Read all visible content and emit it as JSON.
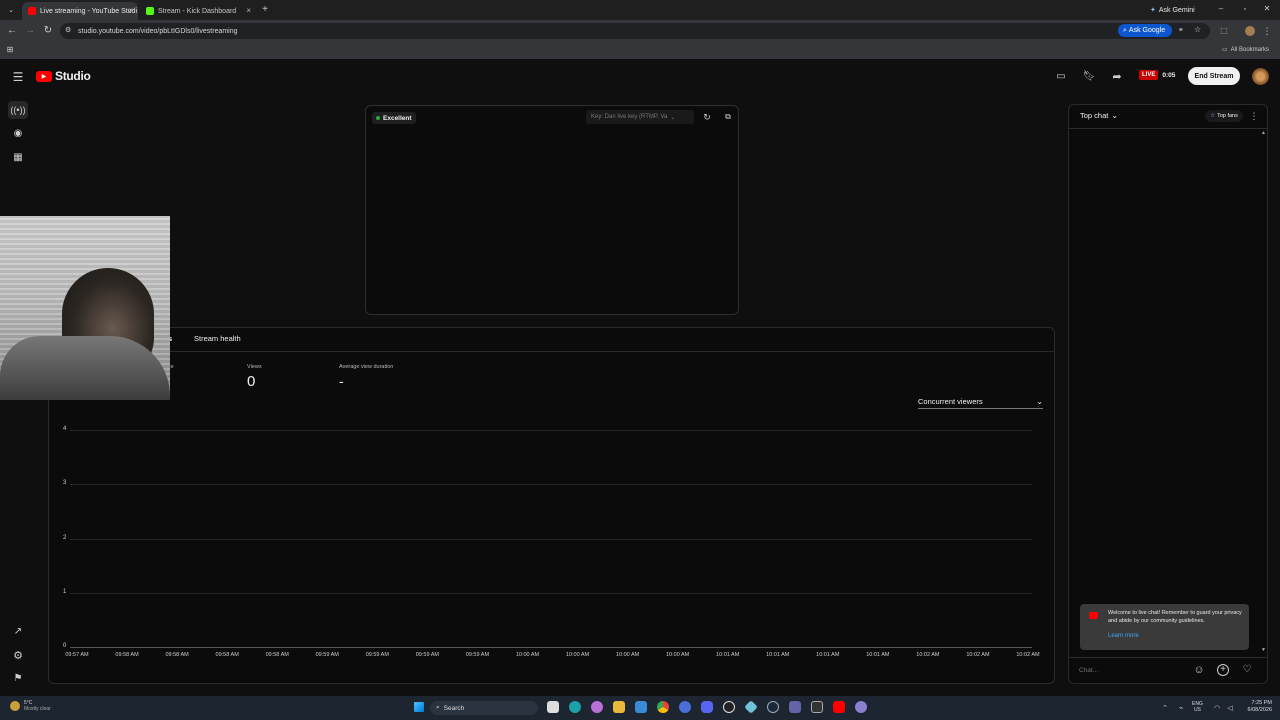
{
  "browser": {
    "tabs": [
      {
        "label": "Live streaming - YouTube Studi",
        "active": true
      },
      {
        "label": "Stream - Kick Dashboard",
        "active": false
      }
    ],
    "ask_gemini": "Ask Gemini",
    "url": "studio.youtube.com/video/pbLtIGDls0/livestreaming",
    "ask_google": "Ask Google",
    "all_bookmarks": "All Bookmarks"
  },
  "studio": {
    "logo_text": "Studio",
    "live_badge": "LIVE",
    "live_time": "0:05",
    "end_stream": "End Stream"
  },
  "preview": {
    "status": "Excellent",
    "stream_key": "Key: Dan live key (RTMP, Va"
  },
  "analytics": {
    "tabs": [
      "s",
      "Stream health"
    ],
    "metrics": [
      {
        "label": "ate",
        "value": ""
      },
      {
        "label": "Views",
        "value": "0"
      },
      {
        "label": "Average view duration",
        "value": "-"
      }
    ],
    "dropdown": "Concurrent viewers"
  },
  "chart_data": {
    "type": "line",
    "x": [
      "09:57 AM",
      "09:58 AM",
      "09:58 AM",
      "09:58 AM",
      "09:58 AM",
      "09:59 AM",
      "09:59 AM",
      "09:59 AM",
      "09:59 AM",
      "10:00 AM",
      "10:00 AM",
      "10:00 AM",
      "10:00 AM",
      "10:01 AM",
      "10:01 AM",
      "10:01 AM",
      "10:01 AM",
      "10:02 AM",
      "10:02 AM",
      "10:02 AM"
    ],
    "yticks": [
      "0",
      "1",
      "2",
      "3",
      "4"
    ],
    "ylim": [
      0,
      4
    ],
    "series": [],
    "grid": true
  },
  "chat": {
    "title": "Top chat",
    "top_fans": "Top fans",
    "welcome": "Welcome to live chat! Remember to guard your privacy and abide by our community guidelines.",
    "learn_more": "Learn more",
    "input_placeholder": "Chat..."
  },
  "taskbar": {
    "temp": "5°C",
    "weather": "Mostly clear",
    "search": "Search",
    "lang": "ENG",
    "region": "US",
    "time": "7:25 PM",
    "date": "6/08/2026"
  },
  "colors": {
    "accent_red": "#ff0000",
    "link_blue": "#3ea6ff",
    "excellent_green": "#2ba640"
  }
}
